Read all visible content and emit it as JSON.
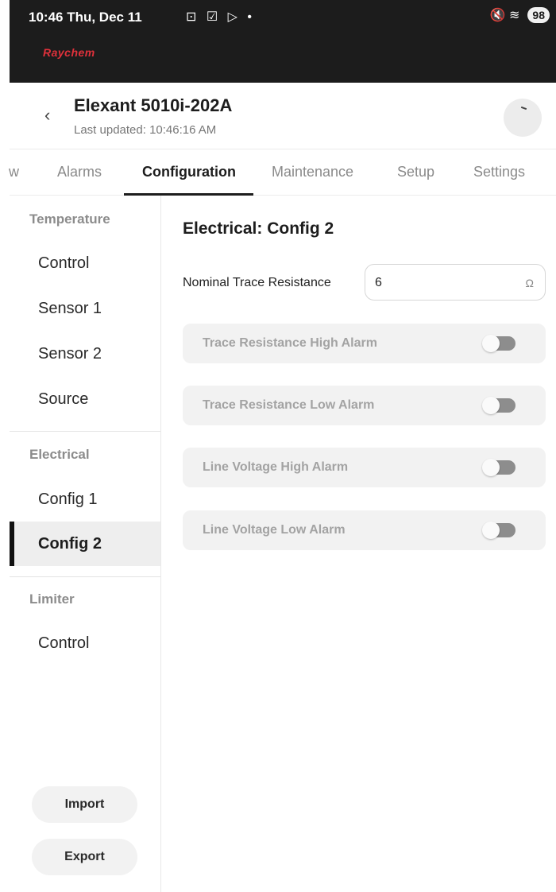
{
  "status_bar": {
    "time": "10:46  Thu, Dec 11",
    "icons": "⊡ ☑ ▷ •",
    "right_icons": "🔇 ≋",
    "battery": "98"
  },
  "brand": "Raychem",
  "header": {
    "back_icon": "‹",
    "title": "Elexant 5010i-202A",
    "last_updated": "Last updated: 10:46:16 AM"
  },
  "tabs": [
    {
      "label": "w"
    },
    {
      "label": "Alarms"
    },
    {
      "label": "Configuration",
      "active": true
    },
    {
      "label": "Maintenance"
    },
    {
      "label": "Setup"
    },
    {
      "label": "Settings"
    }
  ],
  "sidebar": {
    "temperature_title": "Temperature",
    "temperature_items": [
      "Control",
      "Sensor 1",
      "Sensor 2",
      "Source"
    ],
    "electrical_title": "Electrical",
    "electrical_items": [
      "Config 1",
      "Config 2"
    ],
    "limiter_title": "Limiter",
    "limiter_items": [
      "Control"
    ],
    "import_label": "Import",
    "export_label": "Export"
  },
  "main": {
    "heading": "Electrical: Config 2",
    "nominal_label": "Nominal Trace Resistance",
    "nominal_value": "6",
    "nominal_unit": "Ω",
    "alarms": [
      {
        "label": "Trace Resistance High Alarm",
        "enabled": false
      },
      {
        "label": "Trace Resistance Low Alarm",
        "enabled": false
      },
      {
        "label": "Line Voltage High Alarm",
        "enabled": false
      },
      {
        "label": "Line Voltage Low Alarm",
        "enabled": false
      }
    ]
  },
  "colors": {
    "brand_red": "#e0313b",
    "topbar": "#1c1c1c",
    "toggle_off": "#8d8d8d"
  }
}
